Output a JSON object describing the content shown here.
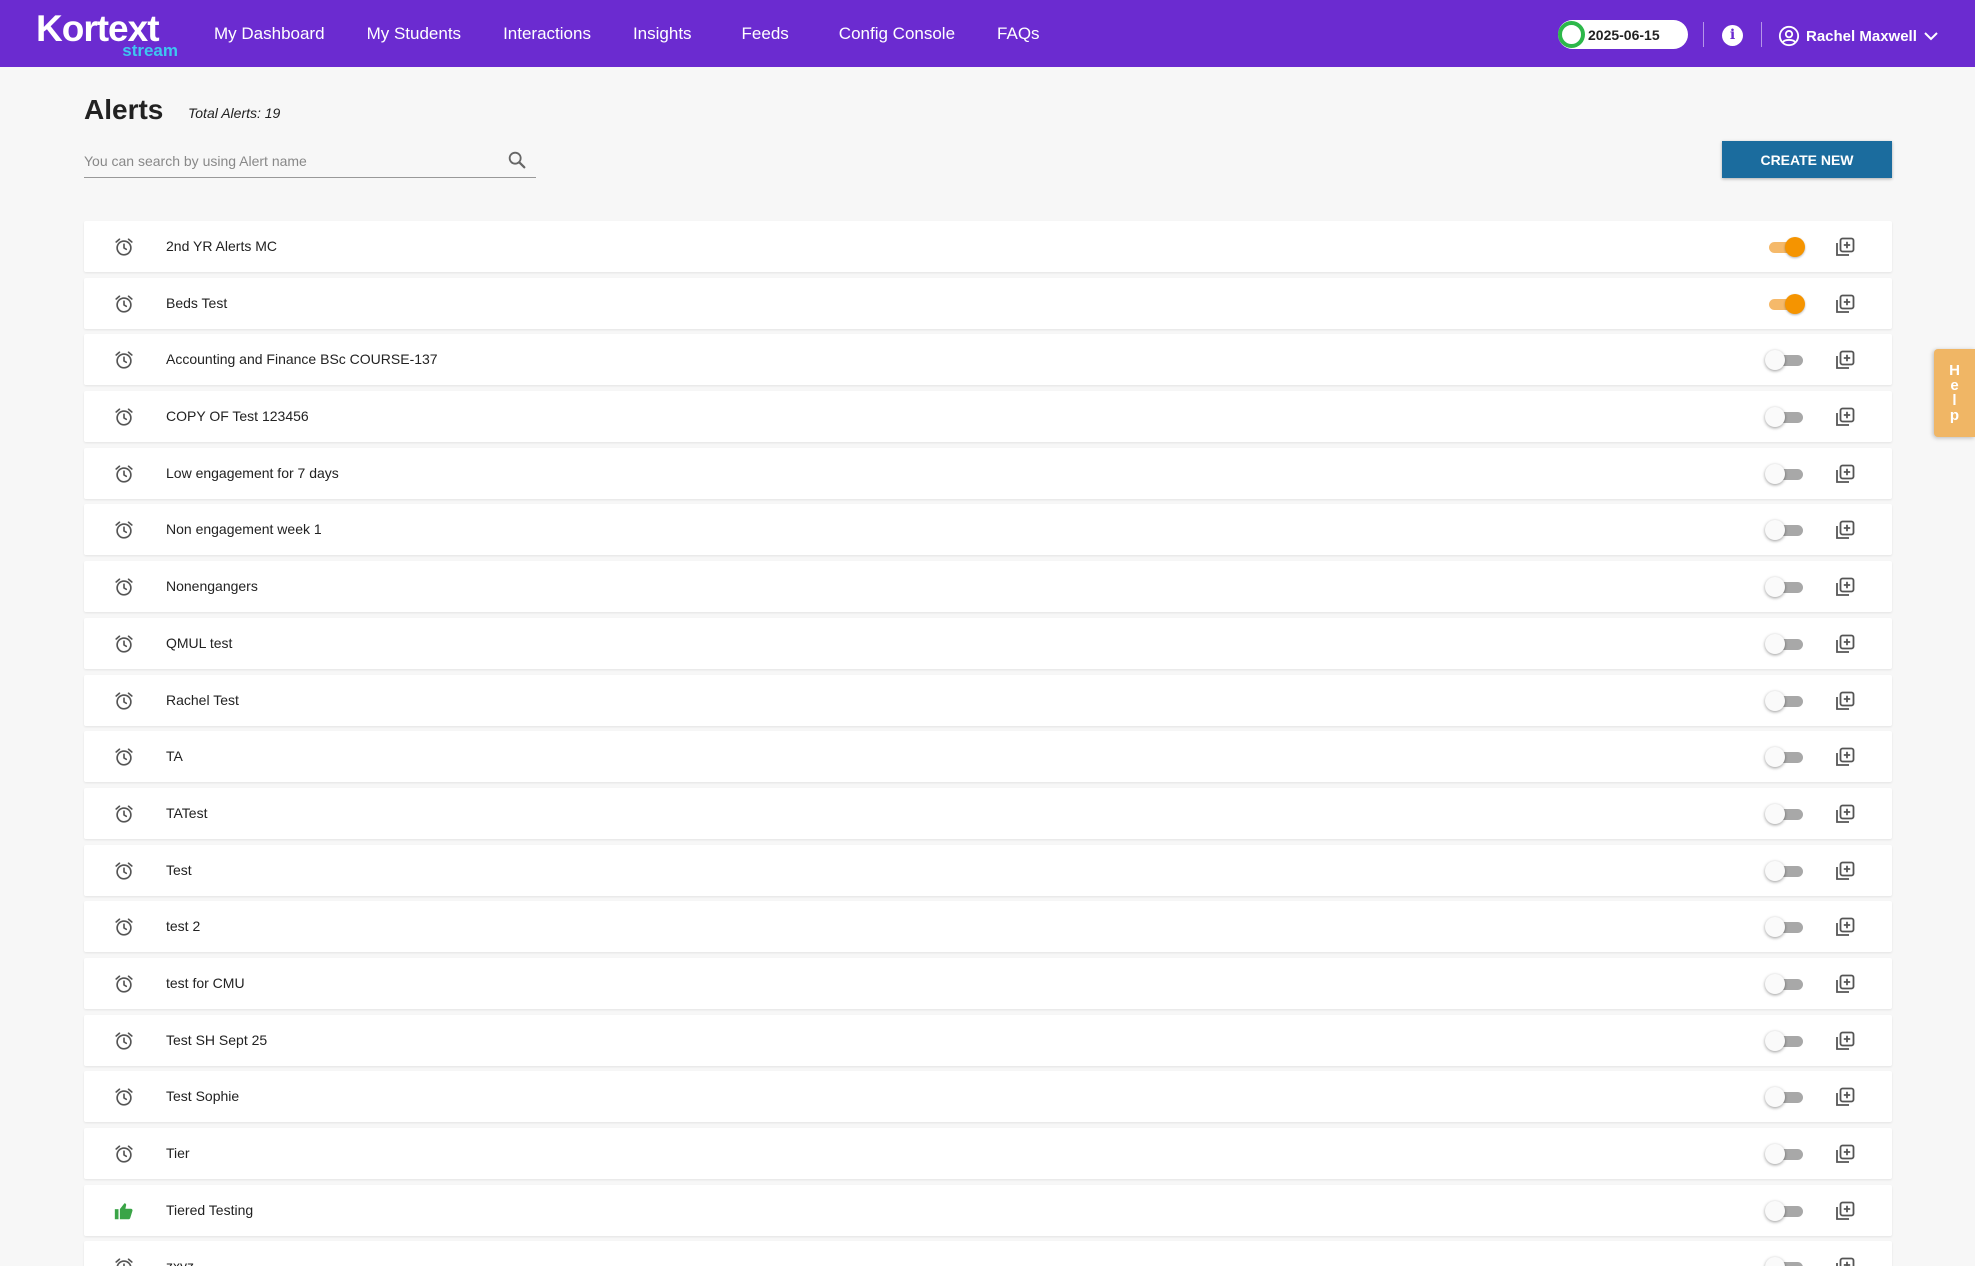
{
  "brand": {
    "name": "Kortext",
    "sub": "stream"
  },
  "nav": {
    "items": [
      "My Dashboard",
      "My Students",
      "Interactions",
      "Insights",
      "Feeds",
      "Config Console",
      "FAQs"
    ]
  },
  "header": {
    "date": "2025-06-15",
    "user_name": "Rachel Maxwell"
  },
  "page": {
    "title": "Alerts",
    "total_label": "Total Alerts: 19",
    "search_placeholder": "You can search by using Alert name",
    "create_label": "CREATE NEW"
  },
  "help": {
    "letters": [
      "H",
      "e",
      "l",
      "p"
    ]
  },
  "alerts": [
    {
      "name": "2nd YR Alerts MC",
      "enabled": true,
      "icon": "alarm-clock-icon"
    },
    {
      "name": "Beds Test",
      "enabled": true,
      "icon": "alarm-clock-icon"
    },
    {
      "name": "Accounting and Finance BSc COURSE-137",
      "enabled": false,
      "icon": "alarm-clock-icon"
    },
    {
      "name": "COPY OF Test 123456",
      "enabled": false,
      "icon": "alarm-clock-icon"
    },
    {
      "name": "Low engagement for 7 days",
      "enabled": false,
      "icon": "alarm-clock-icon"
    },
    {
      "name": "Non engagement week 1",
      "enabled": false,
      "icon": "alarm-clock-icon"
    },
    {
      "name": "Nonengangers",
      "enabled": false,
      "icon": "alarm-clock-icon"
    },
    {
      "name": "QMUL test",
      "enabled": false,
      "icon": "alarm-clock-icon"
    },
    {
      "name": "Rachel Test",
      "enabled": false,
      "icon": "alarm-clock-icon"
    },
    {
      "name": "TA",
      "enabled": false,
      "icon": "alarm-clock-icon"
    },
    {
      "name": "TATest",
      "enabled": false,
      "icon": "alarm-clock-icon"
    },
    {
      "name": "Test",
      "enabled": false,
      "icon": "alarm-clock-icon"
    },
    {
      "name": "test 2",
      "enabled": false,
      "icon": "alarm-clock-icon"
    },
    {
      "name": "test for CMU",
      "enabled": false,
      "icon": "alarm-clock-icon"
    },
    {
      "name": "Test SH Sept 25",
      "enabled": false,
      "icon": "alarm-clock-icon"
    },
    {
      "name": "Test Sophie",
      "enabled": false,
      "icon": "alarm-clock-icon"
    },
    {
      "name": "Tier",
      "enabled": false,
      "icon": "alarm-clock-icon"
    },
    {
      "name": "Tiered Testing",
      "enabled": false,
      "icon": "thumbs-up-icon"
    },
    {
      "name": "zxyz",
      "enabled": false,
      "icon": "alarm-clock-icon"
    }
  ],
  "colors": {
    "header_bg": "#6b2bd0",
    "primary_button": "#1b6c9e",
    "toggle_on": "#f59400",
    "help_tab": "#f0b665",
    "status_green": "#2db84a"
  }
}
